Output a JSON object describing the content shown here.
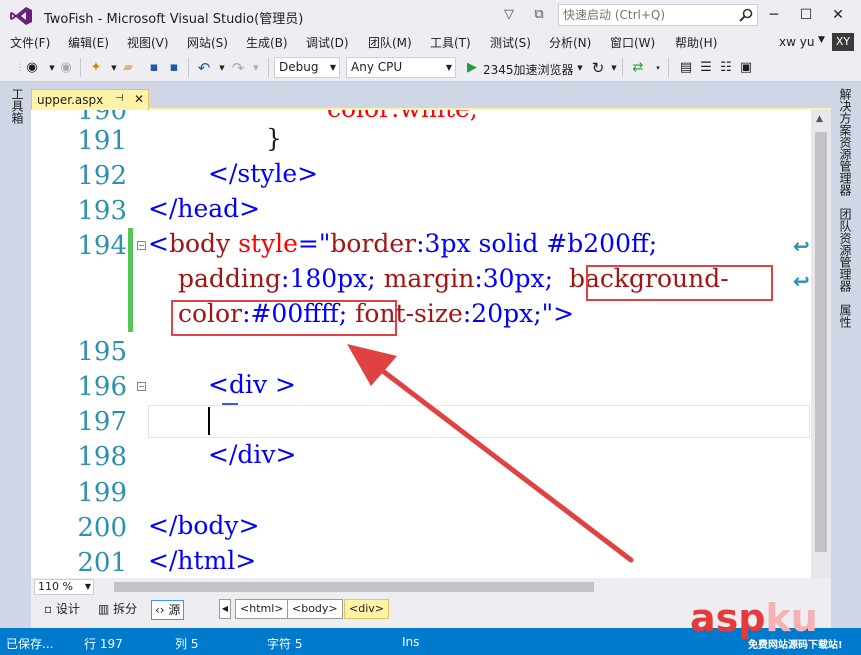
{
  "window": {
    "title": "TwoFish - Microsoft Visual Studio(管理员)",
    "quicklaunch_placeholder": "快速启动 (Ctrl+Q)",
    "minimize": "─",
    "maximize": "☐",
    "close": "✕"
  },
  "menu": [
    "文件(F)",
    "编辑(E)",
    "视图(V)",
    "网站(S)",
    "生成(B)",
    "调试(D)",
    "团队(M)",
    "工具(T)",
    "测试(S)",
    "分析(N)",
    "窗口(W)",
    "帮助(H)"
  ],
  "user": {
    "name": "xw yu",
    "initials": "XY"
  },
  "toolbar": {
    "config": "Debug",
    "platform": "Any CPU",
    "run_target": "2345加速浏览器"
  },
  "left_panel": {
    "toolbox": "工具箱"
  },
  "right_panels": [
    "解决方案资源管理器",
    "团队资源管理器",
    "属性"
  ],
  "tab": {
    "label": "upper.aspx",
    "pin": "⊣",
    "close": "✕"
  },
  "editor": {
    "lines": [
      {
        "num": "190",
        "partial": "color:white;"
      },
      {
        "num": "191",
        "text": "}"
      },
      {
        "num": "192",
        "text": "</style>"
      },
      {
        "num": "193",
        "text": "</head>"
      },
      {
        "num": "194",
        "tag_open": "<",
        "tag": "body",
        "attr": "style",
        "eq": "=",
        "quote": "\"",
        "v1": "border",
        "v1c": ":3px solid #b200ff;",
        "v2": "padding",
        "v2c": ":180px; ",
        "v3": "margin",
        "v3c": ":30px; ",
        "v4": "background-",
        "v5": "color",
        "v5c": ":#00ffff;",
        "v6": "font-size",
        "v6c": ":20px;",
        "quote2": "\"",
        "tag_close": ">"
      },
      {
        "num": "195",
        "text": ""
      },
      {
        "num": "196",
        "text": "<div >"
      },
      {
        "num": "197",
        "text": ""
      },
      {
        "num": "198",
        "text": "</div>"
      },
      {
        "num": "199",
        "text": ""
      },
      {
        "num": "200",
        "text": "</body>"
      },
      {
        "num": "201",
        "text": "</html>"
      }
    ]
  },
  "zoom": "110 %",
  "views": {
    "design": "设计",
    "split": "拆分",
    "source": "源"
  },
  "breadcrumbs": [
    "<html>",
    "<body>",
    "<div>"
  ],
  "status": {
    "saved": "已保存...",
    "line": "行 197",
    "col": "列 5",
    "char": "字符 5",
    "mode": "Ins"
  },
  "watermark": {
    "asp": "asp",
    "ku": "ku",
    "sub": "免费网站源码下载站!"
  }
}
